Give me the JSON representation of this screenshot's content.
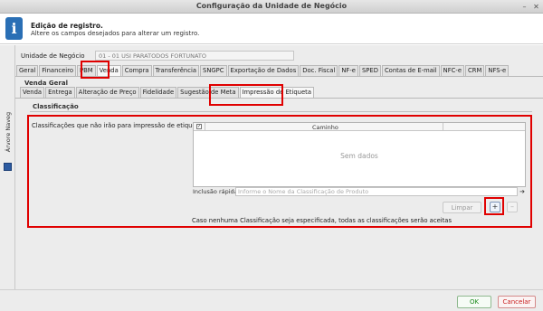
{
  "window": {
    "title": "Configuração da Unidade de Negócio",
    "minimize_glyph": "–",
    "close_glyph": "✕"
  },
  "info": {
    "icon_glyph": "i",
    "title": "Edição de registro.",
    "subtitle": "Altere os campos desejados para alterar um registro."
  },
  "sidebar": {
    "label": "Árvore Naveg"
  },
  "business_unit": {
    "label": "Unidade de Negócio",
    "value": "01 - 01 USI PARATODOS FORTUNATO"
  },
  "main_tabs": [
    {
      "label": "Geral"
    },
    {
      "label": "Financeiro"
    },
    {
      "label": "PBM"
    },
    {
      "label": "Venda"
    },
    {
      "label": "Compra"
    },
    {
      "label": "Transferência"
    },
    {
      "label": "SNGPC"
    },
    {
      "label": "Exportação de Dados"
    },
    {
      "label": "Doc. Fiscal"
    },
    {
      "label": "NF-e"
    },
    {
      "label": "SPED"
    },
    {
      "label": "Contas de E-mail"
    },
    {
      "label": "NFC-e"
    },
    {
      "label": "CRM"
    },
    {
      "label": "NFS-e"
    }
  ],
  "venda_section": {
    "title": "Venda Geral"
  },
  "sub_tabs": [
    {
      "label": "Venda"
    },
    {
      "label": "Entrega"
    },
    {
      "label": "Alteração de Preço"
    },
    {
      "label": "Fidelidade"
    },
    {
      "label": "Sugestão de Meta"
    },
    {
      "label": "Impressão de Etiqueta"
    }
  ],
  "classification": {
    "section_title": "Classificação",
    "field_label": "Classificações que não irão para impressão de etiqueta",
    "grid": {
      "column": "Caminho",
      "check_glyph": "✓",
      "empty_text": "Sem dados"
    },
    "quick_add": {
      "label": "Inclusão rápida",
      "placeholder": "Informe o Nome da Classificação de Produto",
      "arrow_glyph": "➔"
    },
    "buttons": {
      "clear": "Limpar",
      "add": "+",
      "remove": "–"
    },
    "note": "Caso nenhuma Classificação seja especificada, todas as classificações serão aceitas"
  },
  "footer": {
    "ok": "OK",
    "cancel": "Cancelar"
  },
  "colors": {
    "highlight": "#e00000",
    "ok_green": "#1a8a1a",
    "cancel_red": "#c81e1e",
    "info_blue": "#2a6fb5"
  }
}
